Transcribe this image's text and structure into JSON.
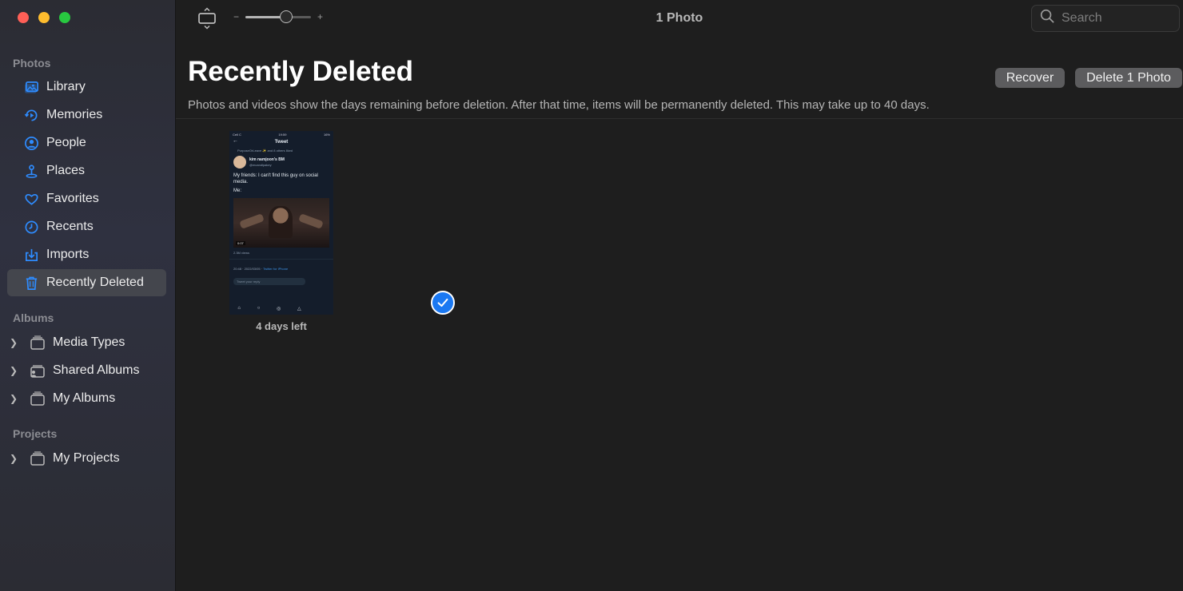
{
  "window": {
    "title": "1 Photo",
    "traffic_lights": [
      "close",
      "minimize",
      "maximize"
    ]
  },
  "toolbar": {
    "zoom_minus": "−",
    "zoom_plus": "+",
    "zoom_level": 0.62,
    "search_placeholder": "Search"
  },
  "sidebar": {
    "photos_title": "Photos",
    "items": [
      {
        "label": "Library",
        "icon": "library-icon"
      },
      {
        "label": "Memories",
        "icon": "memories-icon"
      },
      {
        "label": "People",
        "icon": "people-icon"
      },
      {
        "label": "Places",
        "icon": "places-icon"
      },
      {
        "label": "Favorites",
        "icon": "favorites-icon"
      },
      {
        "label": "Recents",
        "icon": "recents-icon"
      },
      {
        "label": "Imports",
        "icon": "imports-icon"
      },
      {
        "label": "Recently Deleted",
        "icon": "trash-icon",
        "active": true
      }
    ],
    "albums_title": "Albums",
    "albums": [
      {
        "label": "Media Types"
      },
      {
        "label": "Shared Albums"
      },
      {
        "label": "My Albums"
      }
    ],
    "projects_title": "Projects",
    "projects": [
      {
        "label": "My Projects"
      }
    ]
  },
  "main": {
    "title": "Recently Deleted",
    "subtitle": "Photos and videos show the days remaining before deletion. After that time, items will be permanently deleted. This may take up to 40 days.",
    "recover_label": "Recover",
    "delete_label": "Delete 1 Photo",
    "photo": {
      "days_left": "4 days left",
      "selected": true,
      "screenshot": {
        "status_left": "Cell C",
        "status_time": "19:59",
        "status_right": "16%",
        "header": "Tweet",
        "retweeted": "PurposeOrLeave ✨ and 8 others liked",
        "user_name": "kim namjoon's BM",
        "user_handle": "@mcandlpakey",
        "text": "My friends: I can't find this guy on social media.",
        "text2": "Me:",
        "duration": "0:07",
        "views": "2.3M views",
        "timestamp": "20:48 · 2022/03/05 · ",
        "source": "Twitter for iPhone",
        "reply_placeholder": "Tweet your reply"
      }
    }
  },
  "colors": {
    "accent": "#1a78f2",
    "sidebar_icon": "#2e8cff",
    "active_bg": "#44464d",
    "button_bg": "#5c5c5e"
  }
}
